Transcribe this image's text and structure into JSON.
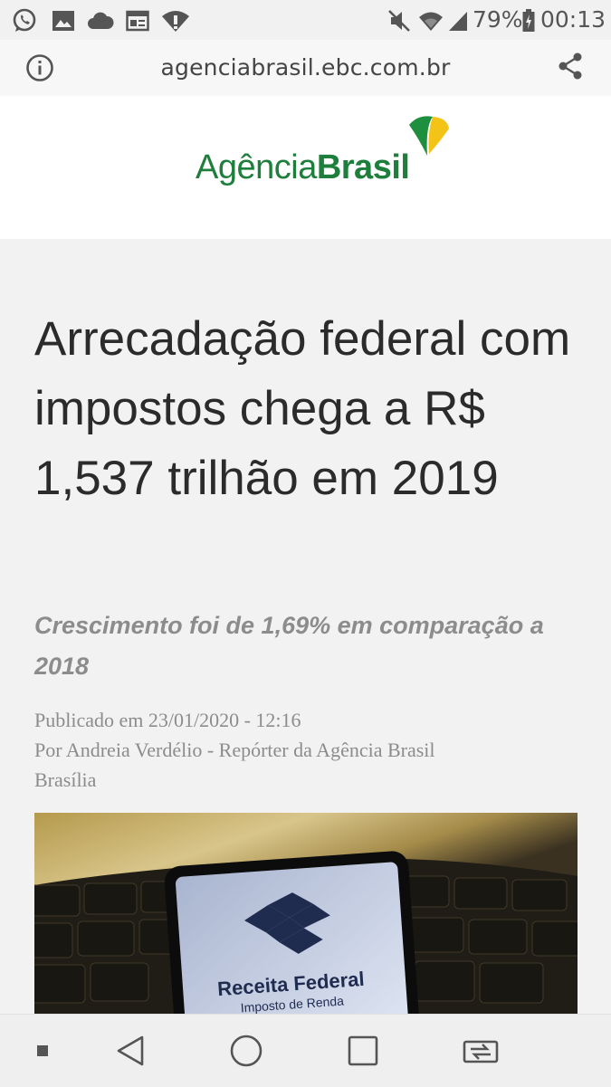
{
  "status_bar": {
    "battery": "79%",
    "time": "00:13",
    "left_icons": [
      "whatsapp-icon",
      "gallery-icon",
      "cloud-icon",
      "news-icon",
      "wifi-warning-icon"
    ],
    "right_icons": [
      "mute-icon",
      "wifi-icon",
      "signal-icon",
      "battery-icon"
    ]
  },
  "browser": {
    "url": "agenciabrasil.ebc.com.br",
    "info_icon": "info-icon",
    "share_icon": "share-icon"
  },
  "site": {
    "logo_light": "Agência",
    "logo_bold": "Brasil",
    "brand_green": "#1e7e3c",
    "brand_yellow": "#f3c318"
  },
  "article": {
    "headline": "Arrecadação federal com impostos chega a R$ 1,537 trilhão em 2019",
    "subtitle": "Crescimento foi de 1,69% em comparação a 2018",
    "published": "Publicado em 23/01/2020 - 12:16",
    "author": "Por Andreia Verdélio - Repórter da Agência Brasil",
    "location": "Brasília",
    "image": {
      "phone_text": "Receita Federal",
      "phone_subtext": "Imposto de Renda"
    }
  },
  "nav_bar": {
    "buttons": [
      "menu-dot-icon",
      "back-icon",
      "home-icon",
      "recents-icon",
      "screen-switch-icon"
    ]
  }
}
